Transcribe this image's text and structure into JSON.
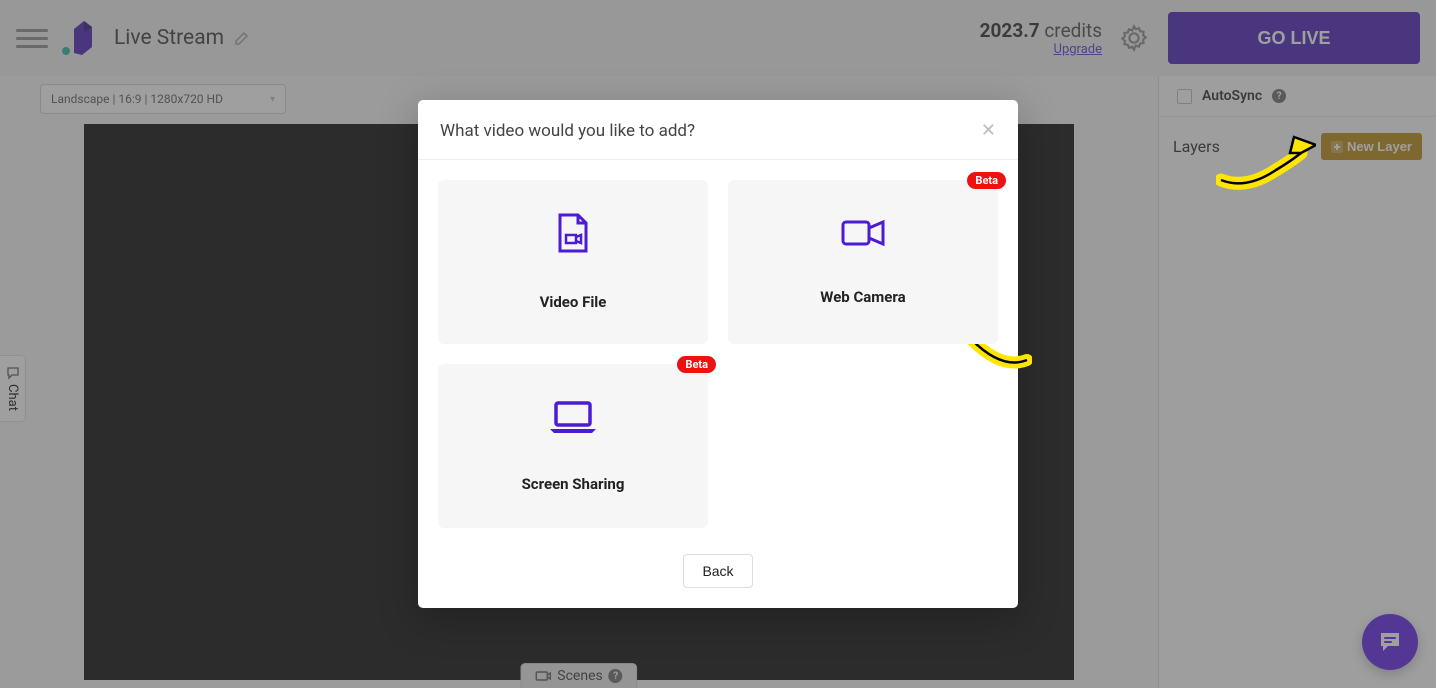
{
  "header": {
    "title": "Live Stream",
    "credits_value": "2023.7",
    "credits_label": "credits",
    "upgrade": "Upgrade",
    "go_live": "GO LIVE"
  },
  "stage": {
    "format": "Landscape | 16:9 | 1280x720 HD",
    "scenes_label": "Scenes"
  },
  "right": {
    "autosync": "AutoSync",
    "layers": "Layers",
    "new_layer": "New Layer"
  },
  "chat_tab": "Chat",
  "modal": {
    "title": "What video would you like to add?",
    "beta": "Beta",
    "cards": {
      "video_file": "Video File",
      "web_camera": "Web Camera",
      "screen_sharing": "Screen Sharing"
    },
    "back": "Back"
  },
  "colors": {
    "primary": "#4416b8",
    "accent": "#b8860b",
    "beta": "#e11"
  }
}
